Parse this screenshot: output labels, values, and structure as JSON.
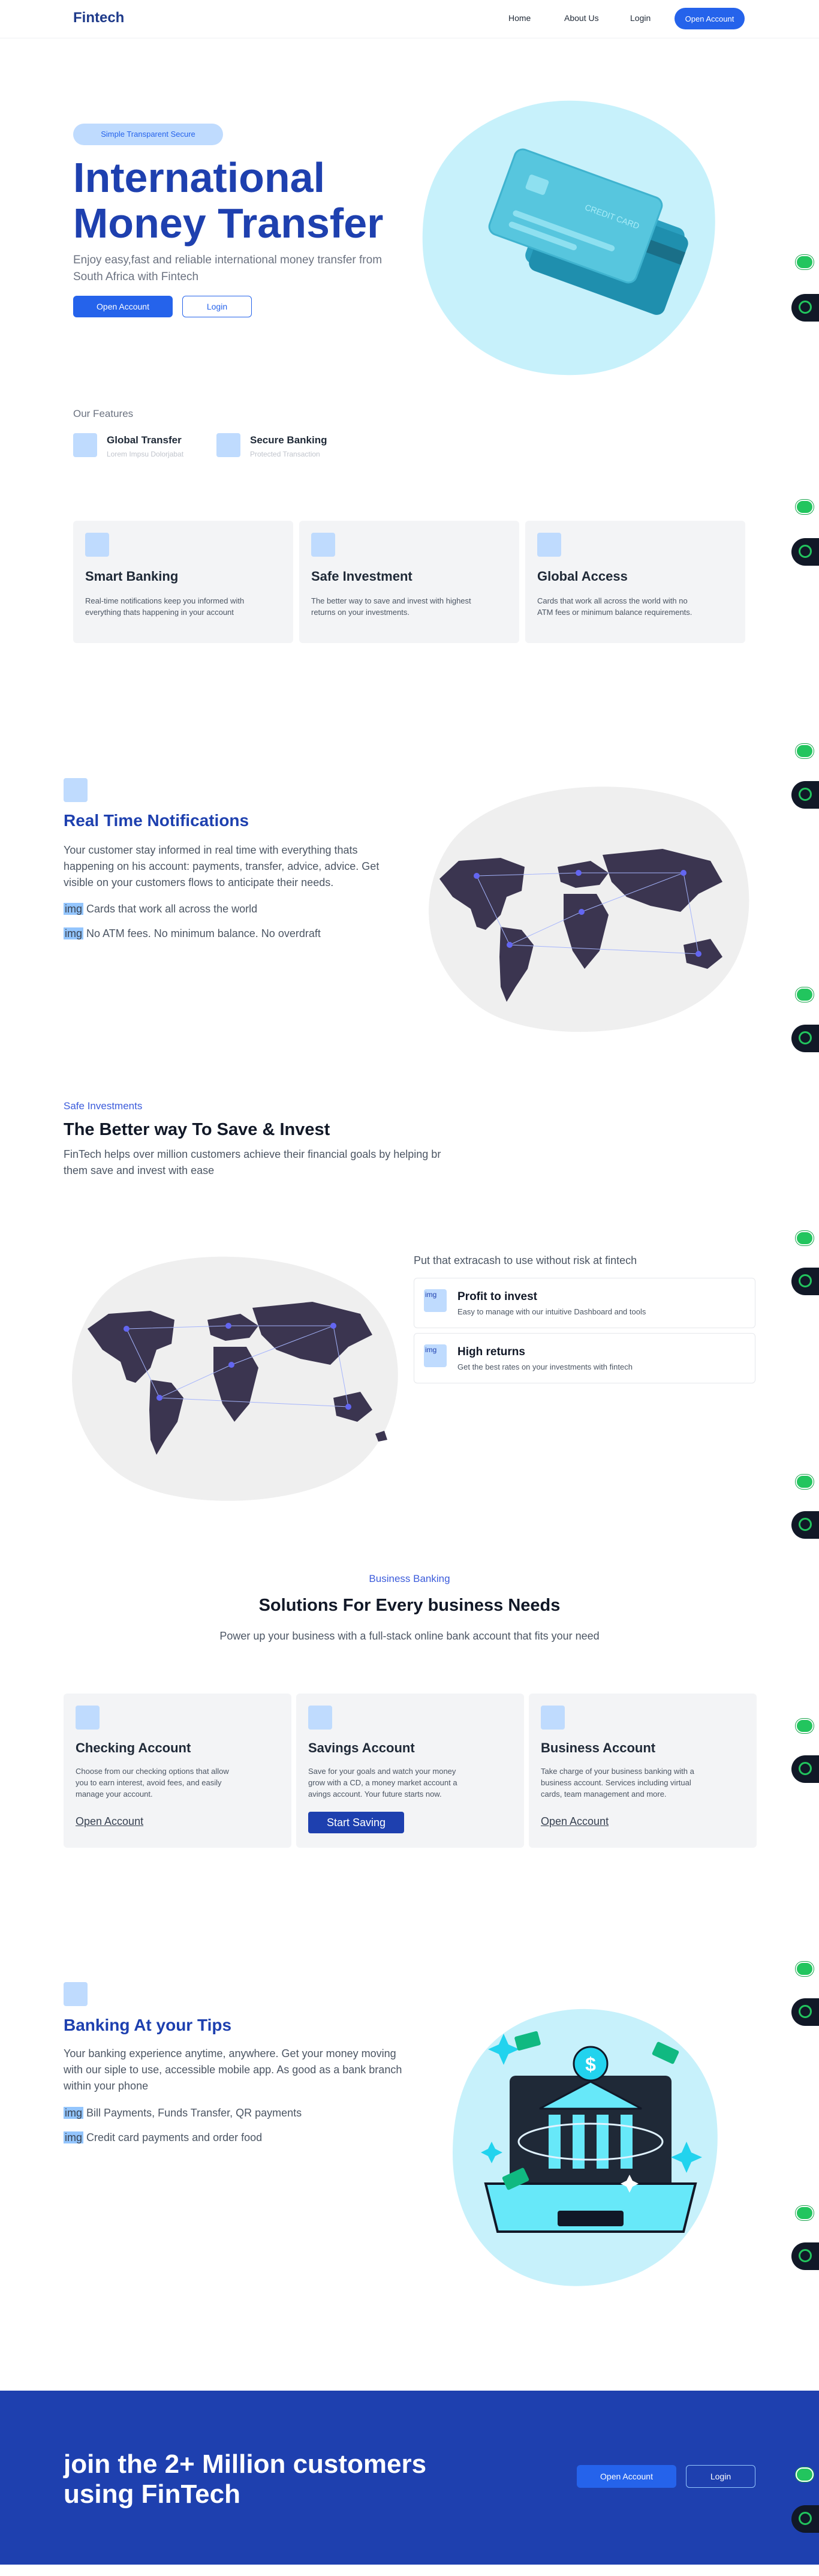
{
  "nav": {
    "logo": "Fintech",
    "links": [
      "Home",
      "About Us",
      "Login"
    ],
    "cta": "Open Account"
  },
  "hero": {
    "pill": "Simple Transparent Secure",
    "title_line1": "International",
    "title_line2": "Money Transfer",
    "subtitle": "Enjoy easy,fast and reliable international money transfer from South Africa with Fintech",
    "primary_button": "Open Account",
    "secondary_button": "Login",
    "card_text": "CREDIT CARD"
  },
  "features": {
    "label": "Our Features",
    "mini": [
      {
        "title": "Global Transfer",
        "subtitle": "Lorem Impsu Dolorjabat"
      },
      {
        "title": "Secure Banking",
        "subtitle": "Protected Transaction"
      }
    ],
    "cards": [
      {
        "title": "Smart Banking",
        "desc": "Real-time notifications keep you informed with everything thats happening in your account"
      },
      {
        "title": "Safe Investment",
        "desc": "The better way to save and invest with highest returns on your investments."
      },
      {
        "title": "Global Access",
        "desc": "Cards that work all across the world with no ATM fees or minimum balance requirements."
      }
    ]
  },
  "notifications": {
    "title": "Real Time Notifications",
    "text": "Your customer stay informed in real time with everything thats happening on his account: payments, transfer, advice, advice. Get visible on your customers flows to anticipate their needs.",
    "bullets": [
      "Cards that work all across the world",
      "No ATM fees. No minimum balance. No overdraft"
    ],
    "img_label": "img"
  },
  "save_invest": {
    "kicker": "Safe Investments",
    "title": "The Better way To Save & Invest",
    "text": "FinTech helps over million customers achieve their financial goals by helping br them save and invest with ease",
    "intro": "Put that extracash to use without risk at fintech",
    "items": [
      {
        "icon_label": "img",
        "title": "Profit to invest",
        "subtitle": "Easy to manage with our intuitive Dashboard and tools"
      },
      {
        "icon_label": "img",
        "title": "High returns",
        "subtitle": "Get the best rates on your investments with fintech"
      }
    ]
  },
  "business": {
    "kicker": "Business Banking",
    "title": "Solutions For Every business Needs",
    "subtitle": "Power up your business with a full-stack online bank account that fits your need",
    "accounts": [
      {
        "title": "Checking Account",
        "desc": "Choose from our checking options that allow you to earn interest, avoid fees, and easily manage your account.",
        "action": "Open Account"
      },
      {
        "title": "Savings Account",
        "desc": "Save for your goals and watch your money grow with a CD, a money market account a avings account. Your future starts now.",
        "action": "Start Saving"
      },
      {
        "title": "Business Account",
        "desc": "Take charge of your business banking with a business account. Services including virtual cards, team management and more.",
        "action": "Open Account"
      }
    ]
  },
  "tips": {
    "title": "Banking At your Tips",
    "text": "Your banking experience anytime, anywhere. Get your money moving with our siple to use, accessible mobile app. As good as a bank branch within your phone",
    "bullets": [
      "Bill Payments, Funds Transfer, QR payments",
      "Credit card payments and order food"
    ],
    "img_label": "img",
    "bank_symbol": "$"
  },
  "cta": {
    "title_line1": "join the 2+ Million customers",
    "title_line2": "using FinTech",
    "primary_button": "Open Account",
    "secondary_button": "Login"
  },
  "colors": {
    "brand": "#1e40af",
    "accent": "#2563eb",
    "light_blue": "#bfdbfe",
    "card_bg": "#f3f4f6",
    "map": "#3b3550"
  }
}
